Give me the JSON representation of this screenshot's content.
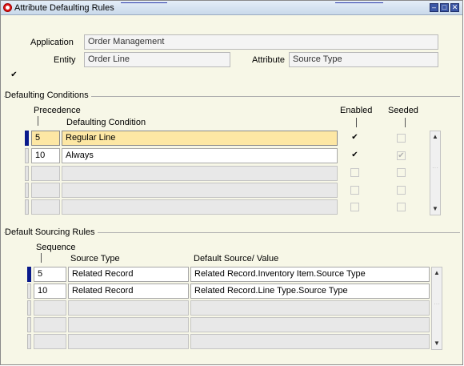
{
  "window": {
    "title": "Attribute Defaulting Rules",
    "minimize": "–",
    "maximize": "□",
    "close": "✕"
  },
  "header": {
    "application_label": "Application",
    "application_value": "Order Management",
    "entity_label": "Entity",
    "entity_value": "Order Line",
    "attribute_label": "Attribute",
    "attribute_value": "Source Type",
    "checkbox_mark": "✔"
  },
  "conditions": {
    "section_title": "Defaulting Conditions",
    "col_precedence": "Precedence",
    "col_condition": "Defaulting Condition",
    "col_enabled": "Enabled",
    "col_seeded": "Seeded",
    "rows": [
      {
        "precedence": "5",
        "condition": "Regular Line",
        "enabled": "✔",
        "seeded": ""
      },
      {
        "precedence": "10",
        "condition": "Always",
        "enabled": "✔",
        "seeded": "✔"
      },
      {
        "precedence": "",
        "condition": "",
        "enabled": "",
        "seeded": ""
      },
      {
        "precedence": "",
        "condition": "",
        "enabled": "",
        "seeded": ""
      },
      {
        "precedence": "",
        "condition": "",
        "enabled": "",
        "seeded": ""
      }
    ]
  },
  "sourcing": {
    "section_title": "Default Sourcing Rules",
    "col_sequence": "Sequence",
    "col_source_type": "Source Type",
    "col_default_value": "Default Source/ Value",
    "rows": [
      {
        "sequence": "5",
        "source_type": "Related Record",
        "value": "Related Record.Inventory Item.Source Type"
      },
      {
        "sequence": "10",
        "source_type": "Related Record",
        "value": "Related Record.Line Type.Source Type"
      },
      {
        "sequence": "",
        "source_type": "",
        "value": ""
      },
      {
        "sequence": "",
        "source_type": "",
        "value": ""
      },
      {
        "sequence": "",
        "source_type": "",
        "value": ""
      }
    ]
  },
  "scroll": {
    "up": "▲",
    "down": "▼"
  }
}
